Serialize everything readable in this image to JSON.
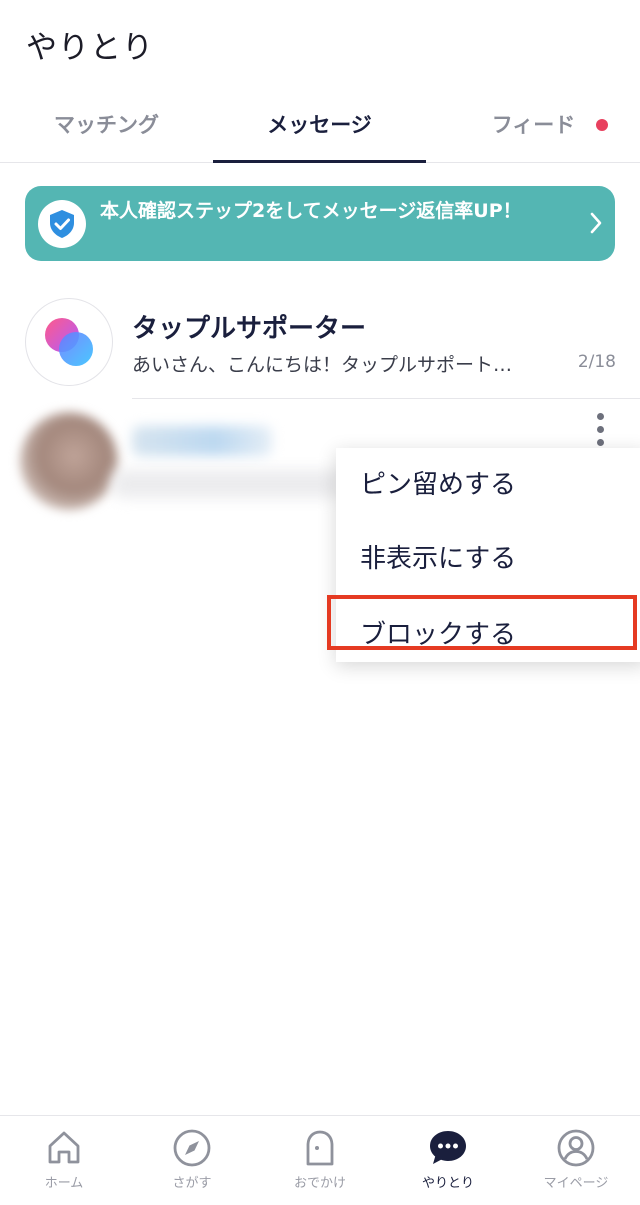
{
  "header": {
    "title": "やりとり"
  },
  "tabs": [
    {
      "label": "マッチング",
      "active": false
    },
    {
      "label": "メッセージ",
      "active": true
    },
    {
      "label": "フィード",
      "active": false,
      "has_badge": true
    }
  ],
  "banner": {
    "text": "本人確認ステップ2をしてメッセージ返信率UP！",
    "icon": "shield-check-icon",
    "color": "#54b6b3"
  },
  "conversations": [
    {
      "name": "タップルサポーター",
      "preview": "あいさん、こんにちは！タップルサポート…",
      "date": "2/18"
    }
  ],
  "context_menu": {
    "items": [
      {
        "label": "ピン留めする"
      },
      {
        "label": "非表示にする"
      },
      {
        "label": "ブロックする",
        "highlighted": true
      }
    ],
    "highlight_color": "#e53a22"
  },
  "bottom_nav": [
    {
      "label": "ホーム",
      "icon": "home-icon",
      "active": false
    },
    {
      "label": "さがす",
      "icon": "compass-icon",
      "active": false
    },
    {
      "label": "おでかけ",
      "icon": "ghost-icon",
      "active": false
    },
    {
      "label": "やりとり",
      "icon": "chat-bubble-icon",
      "active": true
    },
    {
      "label": "マイページ",
      "icon": "profile-icon",
      "active": false
    }
  ],
  "colors": {
    "primary": "#1a1f3d",
    "badge": "#e8405e",
    "muted": "#9a9ca6"
  }
}
